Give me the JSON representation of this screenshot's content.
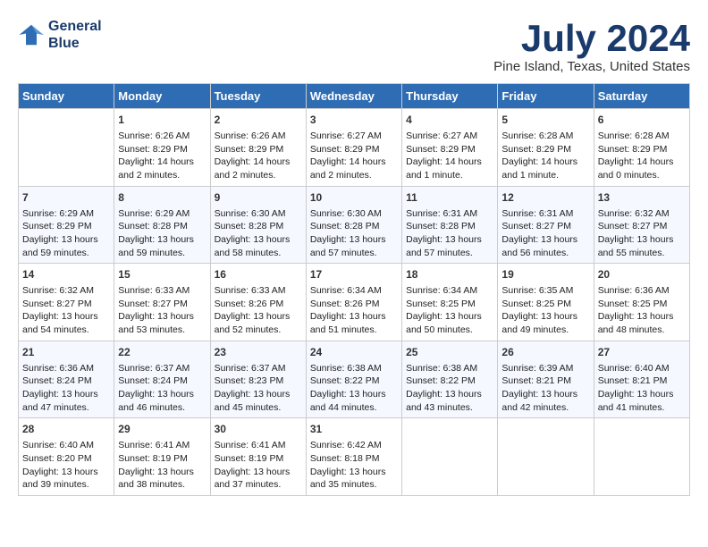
{
  "header": {
    "logo_line1": "General",
    "logo_line2": "Blue",
    "month_title": "July 2024",
    "subtitle": "Pine Island, Texas, United States"
  },
  "days_of_week": [
    "Sunday",
    "Monday",
    "Tuesday",
    "Wednesday",
    "Thursday",
    "Friday",
    "Saturday"
  ],
  "weeks": [
    [
      {
        "num": "",
        "sunrise": "",
        "sunset": "",
        "daylight": ""
      },
      {
        "num": "1",
        "sunrise": "Sunrise: 6:26 AM",
        "sunset": "Sunset: 8:29 PM",
        "daylight": "Daylight: 14 hours and 2 minutes."
      },
      {
        "num": "2",
        "sunrise": "Sunrise: 6:26 AM",
        "sunset": "Sunset: 8:29 PM",
        "daylight": "Daylight: 14 hours and 2 minutes."
      },
      {
        "num": "3",
        "sunrise": "Sunrise: 6:27 AM",
        "sunset": "Sunset: 8:29 PM",
        "daylight": "Daylight: 14 hours and 2 minutes."
      },
      {
        "num": "4",
        "sunrise": "Sunrise: 6:27 AM",
        "sunset": "Sunset: 8:29 PM",
        "daylight": "Daylight: 14 hours and 1 minute."
      },
      {
        "num": "5",
        "sunrise": "Sunrise: 6:28 AM",
        "sunset": "Sunset: 8:29 PM",
        "daylight": "Daylight: 14 hours and 1 minute."
      },
      {
        "num": "6",
        "sunrise": "Sunrise: 6:28 AM",
        "sunset": "Sunset: 8:29 PM",
        "daylight": "Daylight: 14 hours and 0 minutes."
      }
    ],
    [
      {
        "num": "7",
        "sunrise": "Sunrise: 6:29 AM",
        "sunset": "Sunset: 8:29 PM",
        "daylight": "Daylight: 13 hours and 59 minutes."
      },
      {
        "num": "8",
        "sunrise": "Sunrise: 6:29 AM",
        "sunset": "Sunset: 8:28 PM",
        "daylight": "Daylight: 13 hours and 59 minutes."
      },
      {
        "num": "9",
        "sunrise": "Sunrise: 6:30 AM",
        "sunset": "Sunset: 8:28 PM",
        "daylight": "Daylight: 13 hours and 58 minutes."
      },
      {
        "num": "10",
        "sunrise": "Sunrise: 6:30 AM",
        "sunset": "Sunset: 8:28 PM",
        "daylight": "Daylight: 13 hours and 57 minutes."
      },
      {
        "num": "11",
        "sunrise": "Sunrise: 6:31 AM",
        "sunset": "Sunset: 8:28 PM",
        "daylight": "Daylight: 13 hours and 57 minutes."
      },
      {
        "num": "12",
        "sunrise": "Sunrise: 6:31 AM",
        "sunset": "Sunset: 8:27 PM",
        "daylight": "Daylight: 13 hours and 56 minutes."
      },
      {
        "num": "13",
        "sunrise": "Sunrise: 6:32 AM",
        "sunset": "Sunset: 8:27 PM",
        "daylight": "Daylight: 13 hours and 55 minutes."
      }
    ],
    [
      {
        "num": "14",
        "sunrise": "Sunrise: 6:32 AM",
        "sunset": "Sunset: 8:27 PM",
        "daylight": "Daylight: 13 hours and 54 minutes."
      },
      {
        "num": "15",
        "sunrise": "Sunrise: 6:33 AM",
        "sunset": "Sunset: 8:27 PM",
        "daylight": "Daylight: 13 hours and 53 minutes."
      },
      {
        "num": "16",
        "sunrise": "Sunrise: 6:33 AM",
        "sunset": "Sunset: 8:26 PM",
        "daylight": "Daylight: 13 hours and 52 minutes."
      },
      {
        "num": "17",
        "sunrise": "Sunrise: 6:34 AM",
        "sunset": "Sunset: 8:26 PM",
        "daylight": "Daylight: 13 hours and 51 minutes."
      },
      {
        "num": "18",
        "sunrise": "Sunrise: 6:34 AM",
        "sunset": "Sunset: 8:25 PM",
        "daylight": "Daylight: 13 hours and 50 minutes."
      },
      {
        "num": "19",
        "sunrise": "Sunrise: 6:35 AM",
        "sunset": "Sunset: 8:25 PM",
        "daylight": "Daylight: 13 hours and 49 minutes."
      },
      {
        "num": "20",
        "sunrise": "Sunrise: 6:36 AM",
        "sunset": "Sunset: 8:25 PM",
        "daylight": "Daylight: 13 hours and 48 minutes."
      }
    ],
    [
      {
        "num": "21",
        "sunrise": "Sunrise: 6:36 AM",
        "sunset": "Sunset: 8:24 PM",
        "daylight": "Daylight: 13 hours and 47 minutes."
      },
      {
        "num": "22",
        "sunrise": "Sunrise: 6:37 AM",
        "sunset": "Sunset: 8:24 PM",
        "daylight": "Daylight: 13 hours and 46 minutes."
      },
      {
        "num": "23",
        "sunrise": "Sunrise: 6:37 AM",
        "sunset": "Sunset: 8:23 PM",
        "daylight": "Daylight: 13 hours and 45 minutes."
      },
      {
        "num": "24",
        "sunrise": "Sunrise: 6:38 AM",
        "sunset": "Sunset: 8:22 PM",
        "daylight": "Daylight: 13 hours and 44 minutes."
      },
      {
        "num": "25",
        "sunrise": "Sunrise: 6:38 AM",
        "sunset": "Sunset: 8:22 PM",
        "daylight": "Daylight: 13 hours and 43 minutes."
      },
      {
        "num": "26",
        "sunrise": "Sunrise: 6:39 AM",
        "sunset": "Sunset: 8:21 PM",
        "daylight": "Daylight: 13 hours and 42 minutes."
      },
      {
        "num": "27",
        "sunrise": "Sunrise: 6:40 AM",
        "sunset": "Sunset: 8:21 PM",
        "daylight": "Daylight: 13 hours and 41 minutes."
      }
    ],
    [
      {
        "num": "28",
        "sunrise": "Sunrise: 6:40 AM",
        "sunset": "Sunset: 8:20 PM",
        "daylight": "Daylight: 13 hours and 39 minutes."
      },
      {
        "num": "29",
        "sunrise": "Sunrise: 6:41 AM",
        "sunset": "Sunset: 8:19 PM",
        "daylight": "Daylight: 13 hours and 38 minutes."
      },
      {
        "num": "30",
        "sunrise": "Sunrise: 6:41 AM",
        "sunset": "Sunset: 8:19 PM",
        "daylight": "Daylight: 13 hours and 37 minutes."
      },
      {
        "num": "31",
        "sunrise": "Sunrise: 6:42 AM",
        "sunset": "Sunset: 8:18 PM",
        "daylight": "Daylight: 13 hours and 35 minutes."
      },
      {
        "num": "",
        "sunrise": "",
        "sunset": "",
        "daylight": ""
      },
      {
        "num": "",
        "sunrise": "",
        "sunset": "",
        "daylight": ""
      },
      {
        "num": "",
        "sunrise": "",
        "sunset": "",
        "daylight": ""
      }
    ]
  ]
}
